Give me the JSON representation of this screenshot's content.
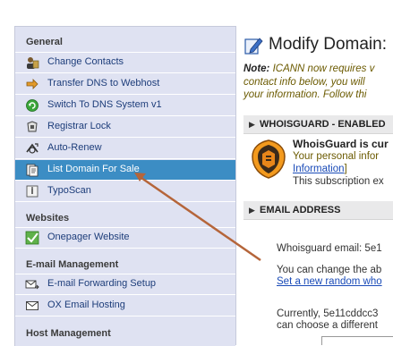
{
  "sidebar": {
    "sections": [
      {
        "title": "General",
        "items": [
          {
            "label": "Change Contacts",
            "icon": "contacts-icon"
          },
          {
            "label": "Transfer DNS to Webhost",
            "icon": "arrow-right-icon"
          },
          {
            "label": "Switch To DNS System v1",
            "icon": "dns-switch-icon"
          },
          {
            "label": "Registrar Lock",
            "icon": "lock-icon"
          },
          {
            "label": "Auto-Renew",
            "icon": "auto-renew-icon"
          },
          {
            "label": "List Domain For Sale",
            "icon": "document-icon",
            "active": true
          },
          {
            "label": "TypoScan",
            "icon": "typoscan-icon"
          }
        ]
      },
      {
        "title": "Websites",
        "items": [
          {
            "label": "Onepager Website",
            "icon": "checkmark-icon"
          }
        ]
      },
      {
        "title": "E-mail Management",
        "items": [
          {
            "label": "E-mail Forwarding Setup",
            "icon": "envelope-forward-icon"
          },
          {
            "label": "OX Email Hosting",
            "icon": "envelope-icon"
          }
        ]
      },
      {
        "title": "Host Management",
        "items": []
      }
    ]
  },
  "main": {
    "title": "Modify Domain:",
    "note_prefix": "Note:",
    "note_line1": " ICANN now requires v",
    "note_line2": "contact info below, you will",
    "note_line3": "your information. Follow thi",
    "whoisguard_bar": "WHOISGUARD - ENABLED",
    "whoisguard_head": "WhoisGuard is cur",
    "whoisguard_line1": "Your personal infor",
    "whoisguard_link": "Information",
    "whoisguard_bracket": "]",
    "whoisguard_line3": "This subscription ex",
    "email_bar": "EMAIL ADDRESS",
    "email_label": "Whoisguard email: 5e1",
    "change_text": "You can change the ab",
    "random_link": "Set a new random who",
    "currently_line1": "Currently, 5e11cddcc3",
    "currently_line2": "can choose a different"
  },
  "colors": {
    "sidebar_bg": "#dfe2f2",
    "active_item": "#3c8dc4",
    "link": "#1a4bb8",
    "note_text": "#6b5a00",
    "annotation_arrow": "#b5653a"
  }
}
